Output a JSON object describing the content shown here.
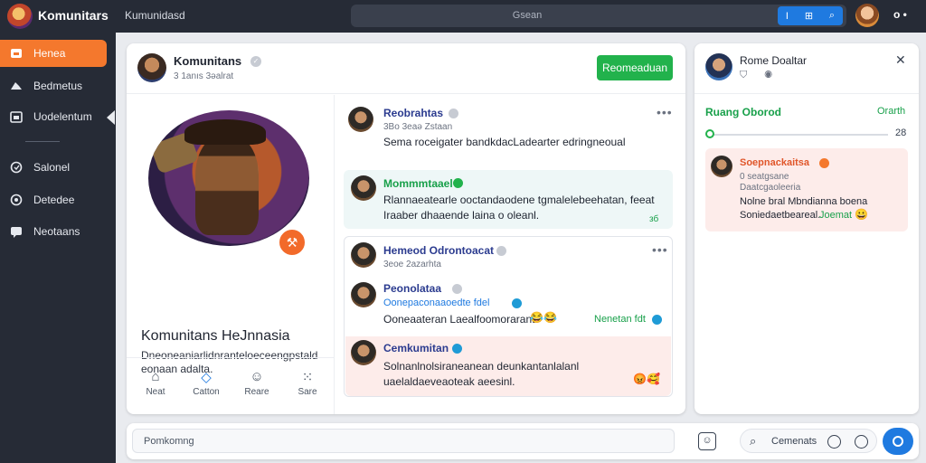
{
  "topbar": {
    "app_title": "Komunitars",
    "subtitle": "Kumunidasd",
    "search_placeholder": "Gsean",
    "search_buttons": [
      "I",
      "⊞",
      "⌕"
    ],
    "more_label": "o •"
  },
  "sidebar": {
    "items": [
      {
        "label": "Henea",
        "icon": "home-icon"
      },
      {
        "label": "Bedmetus",
        "icon": "megaphone-icon"
      },
      {
        "label": "Uodelentum",
        "icon": "calendar-icon"
      },
      {
        "label": "Salonel",
        "icon": "shield-icon"
      },
      {
        "label": "Detedee",
        "icon": "gear-icon"
      },
      {
        "label": "Neotaans",
        "icon": "chat-icon"
      }
    ]
  },
  "header": {
    "title": "Komunitans",
    "meta": "3 1anıs 3əalrat",
    "follow_label": "Reomeaduan"
  },
  "profile": {
    "community_name": "Komunitans HeJnnasia",
    "description": "Dneoneaniarlidnranteloeceengpstald eonaan adalta.",
    "badge_icon": "hammer-icon",
    "tabs": [
      {
        "label": "Neat",
        "icon": "home-icon"
      },
      {
        "label": "Catton",
        "icon": "diamond-icon"
      },
      {
        "label": "Reare",
        "icon": "smile-box-icon"
      },
      {
        "label": "Sare",
        "icon": "grid-icon"
      }
    ]
  },
  "feed": {
    "post1": {
      "name": "Reobrahtas",
      "meta": "3Bo 3eaə Zstaan",
      "text": "Sema roceigater bandkdacLadearter edringneoual"
    },
    "post2": {
      "name": "Mommmtaael",
      "text": "Rlannaeatearle ooctandaodene tgmalelebeehatan, feeat Iraaber dhaaende laina o oleanl.",
      "count": "зб"
    },
    "thread": {
      "head_name": "Hemeod Odrontoacat",
      "head_meta": "3eoe 2azarhta",
      "reply1_name": "Peonolataa",
      "reply1_sub": "Oonepaconaaoedte fdel",
      "reply1_text": "Ooneaateran Laealfoomorarant",
      "reply1_tag": "Nenetan fdt",
      "reply2_name": "Cemkumitan",
      "reply2_text": "Solnanlnolsiraneanean deunkantanlalanl uaelaldaeveaoteak aeesinl."
    }
  },
  "panel": {
    "title": "Rome Doaltar",
    "subtitle_icons": "⛉ ◉",
    "section_label": "Ruang Oborod",
    "section_right": "Orarth",
    "progress_value": "28",
    "progress_fraction": 0.0,
    "message_name": "Soepnackaitsa",
    "message_meta": "0 seatgsane",
    "message_sub": "Daatcgaoleeria",
    "message_text": "Nolne bral Mbndianna boena Soniedaetbeareal.",
    "message_tag": "Joemat"
  },
  "composer": {
    "placeholder": "Pomkomng",
    "comment_label": "Cemenats"
  },
  "colors": {
    "accent_orange": "#f4782d",
    "accent_green": "#22b24c",
    "accent_blue": "#1f7ae0",
    "dark_bg": "#262b36"
  }
}
